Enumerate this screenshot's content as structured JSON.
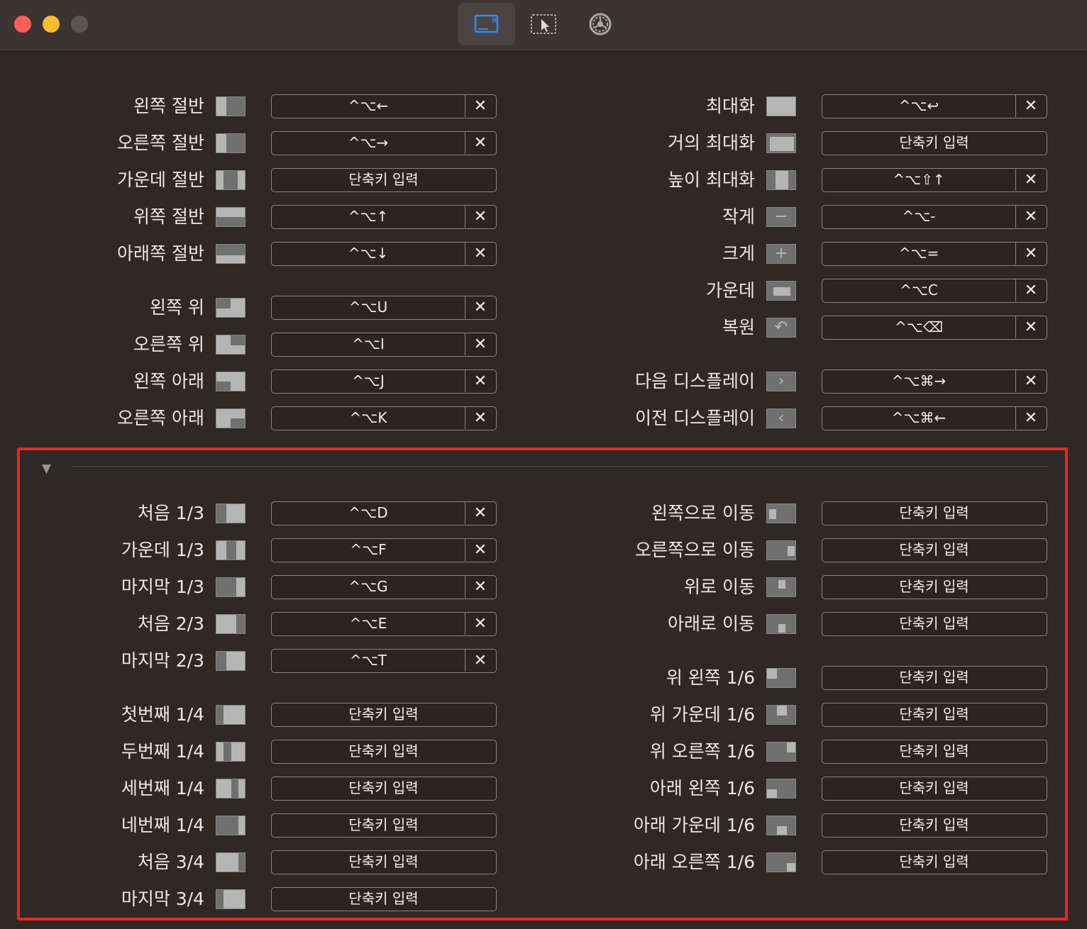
{
  "window": {
    "toolbar": {
      "tabs": [
        {
          "icon": "keyboard-shortcut-icon",
          "active": true
        },
        {
          "icon": "window-snap-icon",
          "active": false
        },
        {
          "icon": "gear-icon",
          "active": false
        }
      ]
    }
  },
  "shortcuts": {
    "left": [
      {
        "label": "왼쪽 절반",
        "shortcut": "^⌥←",
        "clear": "✕"
      },
      {
        "label": "오른쪽 절반",
        "shortcut": "^⌥→",
        "clear": "✕"
      },
      {
        "label": "가운데 절반",
        "shortcut": "단축키 입력"
      },
      {
        "label": "위쪽 절반",
        "shortcut": "^⌥↑",
        "clear": "✕"
      },
      {
        "label": "아래쪽 절반",
        "shortcut": "^⌥↓",
        "clear": "✕"
      },
      {
        "label": "왼쪽 위",
        "shortcut": "^⌥U",
        "clear": "✕"
      },
      {
        "label": "오른쪽 위",
        "shortcut": "^⌥I",
        "clear": "✕"
      },
      {
        "label": "왼쪽 아래",
        "shortcut": "^⌥J",
        "clear": "✕"
      },
      {
        "label": "오른쪽 아래",
        "shortcut": "^⌥K",
        "clear": "✕"
      }
    ],
    "right": [
      {
        "label": "최대화",
        "shortcut": "^⌥↩",
        "clear": "✕"
      },
      {
        "label": "거의 최대화",
        "shortcut": "단축키 입력"
      },
      {
        "label": "높이 최대화",
        "shortcut": "^⌥⇧↑",
        "clear": "✕"
      },
      {
        "label": "작게",
        "shortcut": "^⌥-",
        "clear": "✕"
      },
      {
        "label": "크게",
        "shortcut": "^⌥=",
        "clear": "✕"
      },
      {
        "label": "가운데",
        "shortcut": "^⌥C",
        "clear": "✕"
      },
      {
        "label": "복원",
        "shortcut": "^⌥⌫",
        "clear": "✕"
      },
      {
        "label": "다음 디스플레이",
        "shortcut": "^⌥⌘→",
        "clear": "✕"
      },
      {
        "label": "이전 디스플레이",
        "shortcut": "^⌥⌘←",
        "clear": "✕"
      }
    ]
  },
  "more_shortcuts": {
    "expanded_glyph": "▼",
    "left": [
      {
        "label": "처음 1/3",
        "shortcut": "^⌥D",
        "clear": "✕"
      },
      {
        "label": "가운데 1/3",
        "shortcut": "^⌥F",
        "clear": "✕"
      },
      {
        "label": "마지막 1/3",
        "shortcut": "^⌥G",
        "clear": "✕"
      },
      {
        "label": "처음 2/3",
        "shortcut": "^⌥E",
        "clear": "✕"
      },
      {
        "label": "마지막 2/3",
        "shortcut": "^⌥T",
        "clear": "✕"
      },
      {
        "label": "첫번째 1/4",
        "shortcut": "단축키 입력"
      },
      {
        "label": "두번째 1/4",
        "shortcut": "단축키 입력"
      },
      {
        "label": "세번째 1/4",
        "shortcut": "단축키 입력"
      },
      {
        "label": "네번째 1/4",
        "shortcut": "단축키 입력"
      },
      {
        "label": "처음 3/4",
        "shortcut": "단축키 입력"
      },
      {
        "label": "마지막 3/4",
        "shortcut": "단축키 입력"
      }
    ],
    "right": [
      {
        "label": "왼쪽으로 이동",
        "shortcut": "단축키 입력"
      },
      {
        "label": "오른쪽으로 이동",
        "shortcut": "단축키 입력"
      },
      {
        "label": "위로 이동",
        "shortcut": "단축키 입력"
      },
      {
        "label": "아래로 이동",
        "shortcut": "단축키 입력"
      },
      {
        "label": "위 왼쪽 1/6",
        "shortcut": "단축키 입력"
      },
      {
        "label": "위 가운데 1/6",
        "shortcut": "단축키 입력"
      },
      {
        "label": "위 오른쪽 1/6",
        "shortcut": "단축키 입력"
      },
      {
        "label": "아래 왼쪽 1/6",
        "shortcut": "단축키 입력"
      },
      {
        "label": "아래 가운데 1/6",
        "shortcut": "단축키 입력"
      },
      {
        "label": "아래 오른쪽 1/6",
        "shortcut": "단축키 입력"
      }
    ]
  },
  "colors": {
    "background": "#2e2827",
    "titlebar": "#3a3433",
    "highlight_box": "#ef2418",
    "active_tab_icon": "#2f8cff"
  }
}
